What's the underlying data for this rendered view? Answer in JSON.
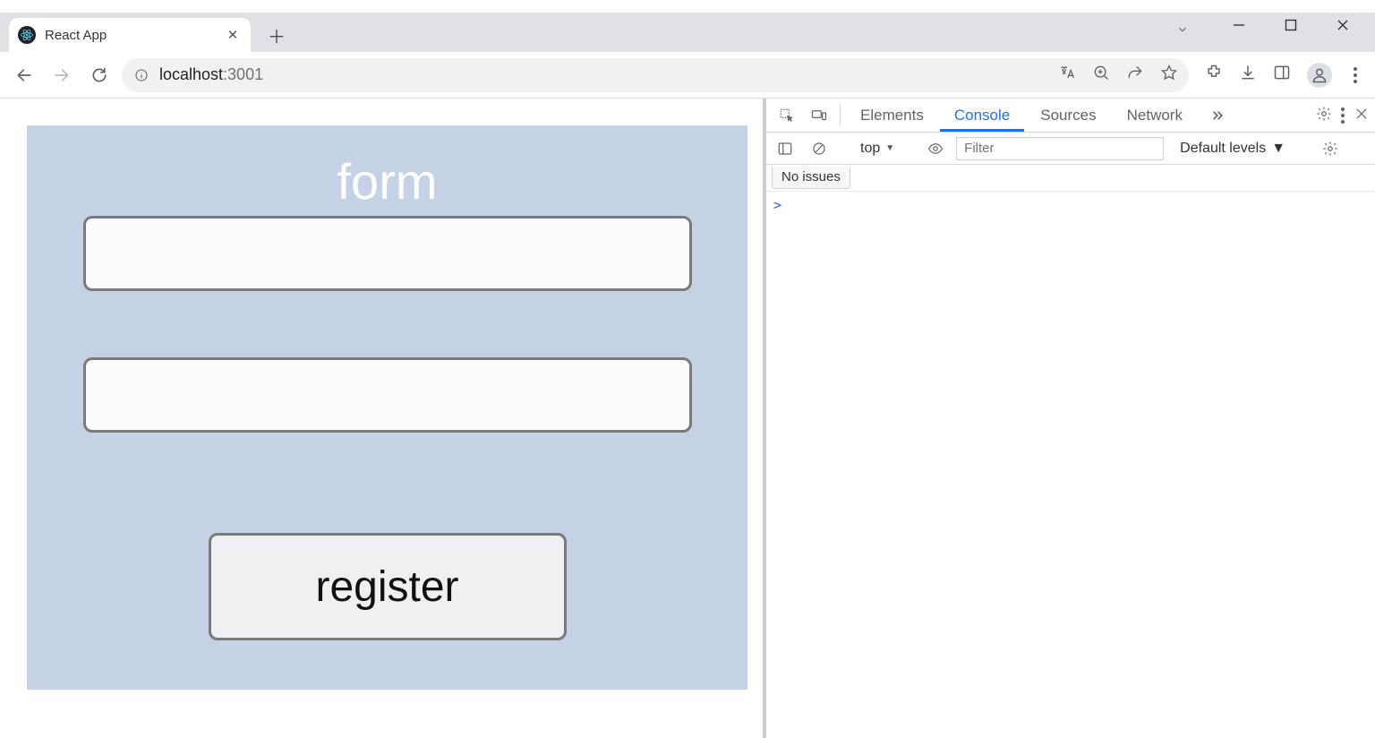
{
  "browser": {
    "tab_title": "React App",
    "url_host": "localhost",
    "url_port": ":3001"
  },
  "app": {
    "form_title": "form",
    "input1_value": "",
    "input2_value": "",
    "register_label": "register"
  },
  "devtools": {
    "tabs": {
      "elements": "Elements",
      "console": "Console",
      "sources": "Sources",
      "network": "Network"
    },
    "context_label": "top",
    "filter_placeholder": "Filter",
    "levels_label": "Default levels",
    "issues_label": "No issues",
    "prompt": ">"
  }
}
